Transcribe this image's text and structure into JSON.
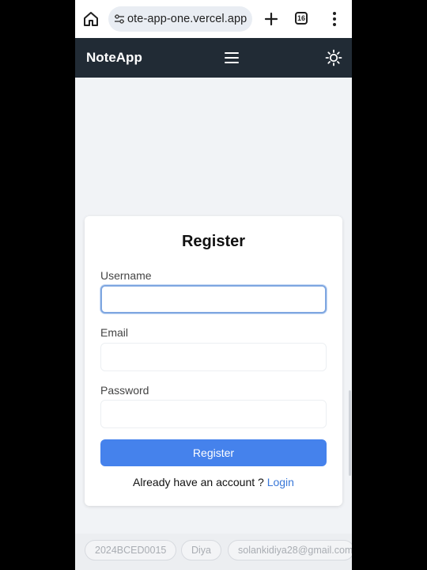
{
  "browser": {
    "url": "ote-app-one.vercel.app",
    "tab_count": "16",
    "icons": [
      "home-icon",
      "site-info-icon",
      "plus-icon",
      "tab-switcher-icon",
      "more-vert-icon"
    ]
  },
  "navbar": {
    "brand": "NoteApp",
    "icons": [
      "hamburger-menu-icon",
      "sun-icon"
    ]
  },
  "register": {
    "title": "Register",
    "username_label": "Username",
    "username_value": "",
    "email_label": "Email",
    "email_value": "",
    "password_label": "Password",
    "password_value": "",
    "submit_label": "Register",
    "login_prompt": "Already have an account ?",
    "login_link": "Login"
  },
  "footer": {
    "chips": [
      "2024BCED0015",
      "Diya",
      "solankidiya28@gmail.com"
    ]
  },
  "colors": {
    "navbar_bg": "#212b35",
    "primary": "#4582ec",
    "link": "#3a78d8",
    "page_bg": "#f1f3f6"
  }
}
